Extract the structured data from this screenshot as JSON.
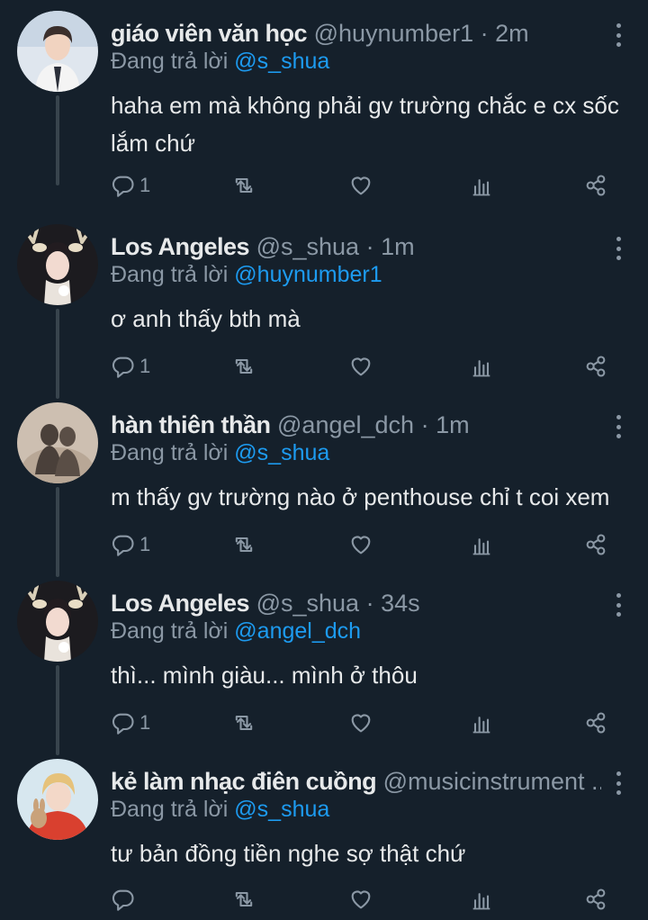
{
  "tweets": [
    {
      "name": "giáo viên văn học",
      "handle": "@huynumber1",
      "time": "2m",
      "replying_label": "Đang trả lời",
      "replying_to": "@s_shua",
      "text": "haha em mà không phải gv trường chắc e cx sốc lắm chứ",
      "reply_count": "1"
    },
    {
      "name": "Los Angeles",
      "handle": "@s_shua",
      "time": "1m",
      "replying_label": "Đang trả lời",
      "replying_to": "@huynumber1",
      "text": "ơ anh thấy bth mà",
      "reply_count": "1"
    },
    {
      "name": "hàn thiên thần",
      "handle": "@angel_dch",
      "time": "1m",
      "replying_label": "Đang trả lời",
      "replying_to": "@s_shua",
      "text": "m thấy gv trường nào ở penthouse chỉ t coi xem",
      "reply_count": "1"
    },
    {
      "name": "Los Angeles",
      "handle": "@s_shua",
      "time": "34s",
      "replying_label": "Đang trả lời",
      "replying_to": "@angel_dch",
      "text": "thì... mình giàu... mình ở thôu",
      "reply_count": "1"
    },
    {
      "name": "kẻ làm nhạc điên cuồng",
      "handle": "@musicinstrument ...",
      "time": "",
      "replying_label": "Đang trả lời",
      "replying_to": "@s_shua",
      "text": "tư bản đồng tiền nghe sợ thật chứ",
      "reply_count": ""
    }
  ],
  "icons": [
    "reply-icon",
    "retweet-icon",
    "like-icon",
    "views-icon",
    "share-icon",
    "more-icon"
  ],
  "colors": {
    "background": "#15202b",
    "text": "#e7e9ea",
    "muted": "#8b98a5",
    "link": "#1d9bf0",
    "thread_line": "#38444d"
  }
}
